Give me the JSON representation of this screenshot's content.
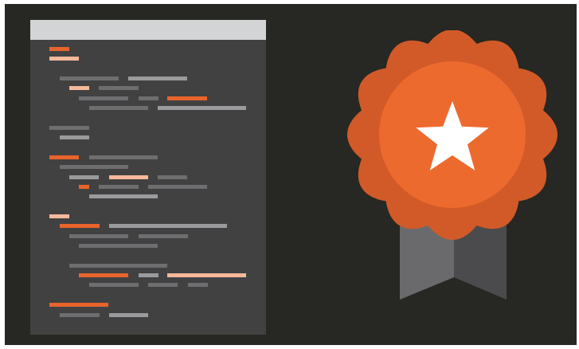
{
  "colors": {
    "background": "#272723",
    "document": "#414142",
    "document_bar": "#d3d4d6",
    "code_orange": "#e8642b",
    "code_peach": "#f6b89a",
    "code_gray": "#6e6e70",
    "code_light_gray": "#9b9b9d",
    "badge_outer": "#d25a28",
    "badge_inner": "#ed6a2e",
    "star": "#ffffff",
    "ribbon_light": "#6a6a6c",
    "ribbon_dark": "#4b4b4d"
  },
  "icons": {
    "document": "code-document-icon",
    "badge": "award-badge-icon",
    "star": "star-icon",
    "ribbon": "ribbon-icon"
  }
}
